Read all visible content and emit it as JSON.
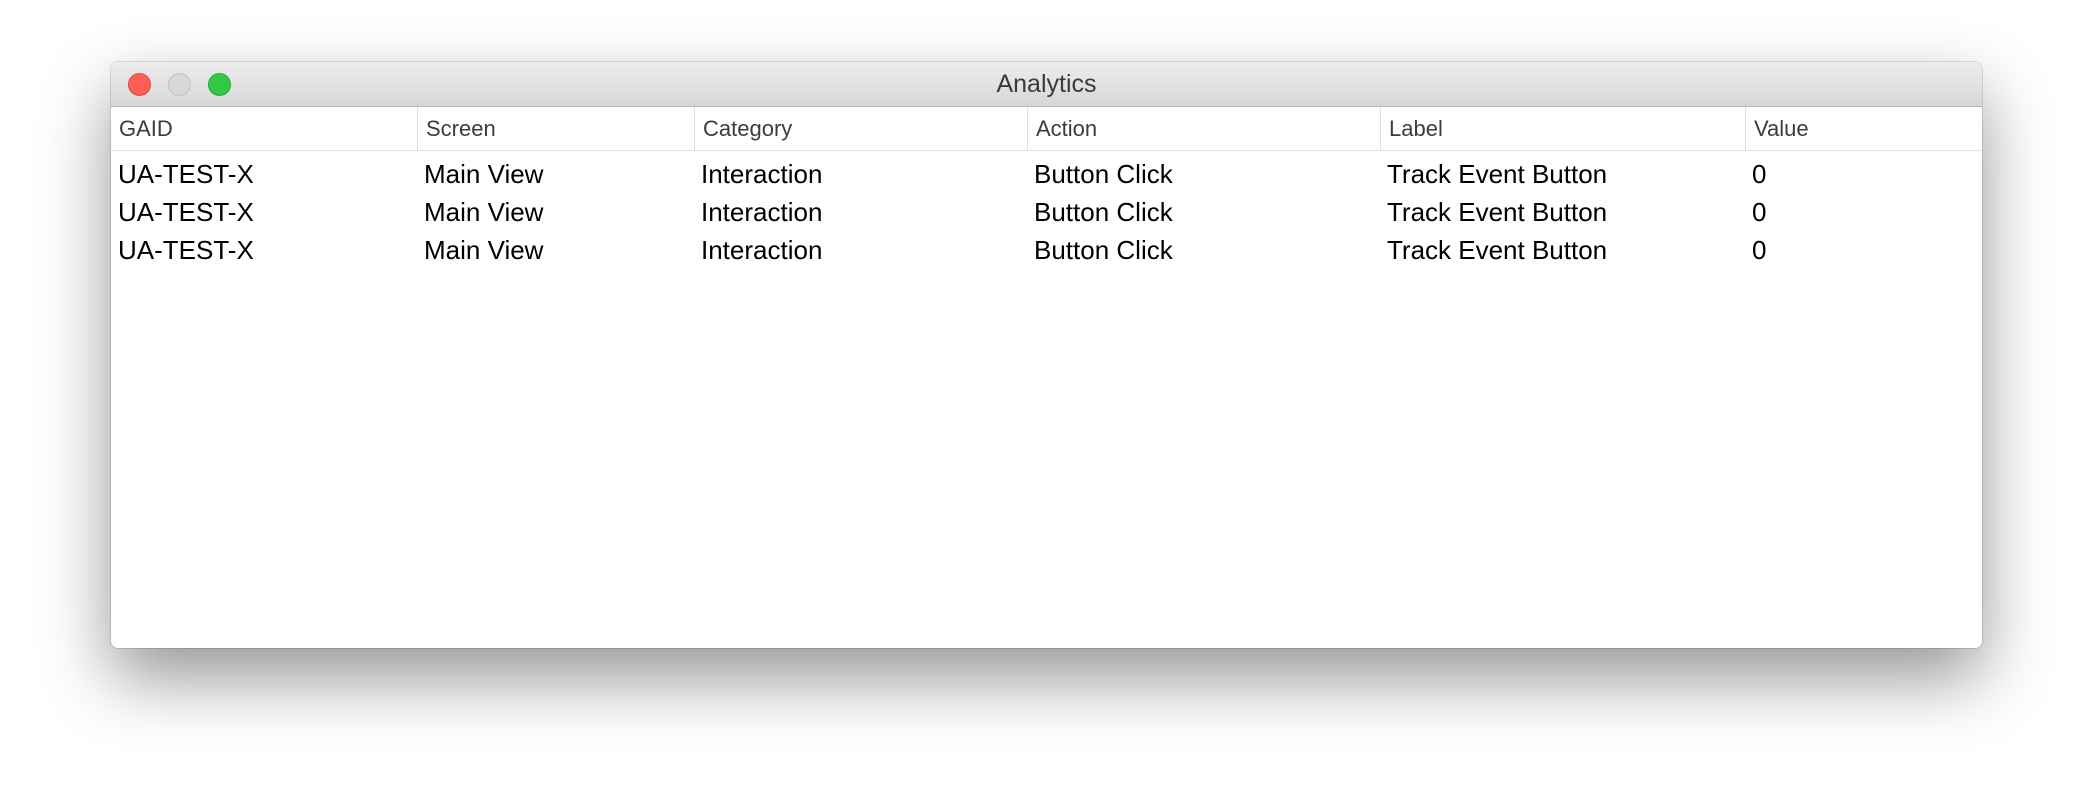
{
  "window": {
    "title": "Analytics"
  },
  "table": {
    "columns": [
      "GAID",
      "Screen",
      "Category",
      "Action",
      "Label",
      "Value"
    ],
    "rows": [
      [
        "UA-TEST-X",
        "Main View",
        "Interaction",
        "Button Click",
        "Track Event Button",
        "0"
      ],
      [
        "UA-TEST-X",
        "Main View",
        "Interaction",
        "Button Click",
        "Track Event Button",
        "0"
      ],
      [
        "UA-TEST-X",
        "Main View",
        "Interaction",
        "Button Click",
        "Track Event Button",
        "0"
      ]
    ]
  },
  "colors": {
    "close": "#fc5f57",
    "minimize": "#d9d8d9",
    "zoom": "#33c748"
  }
}
